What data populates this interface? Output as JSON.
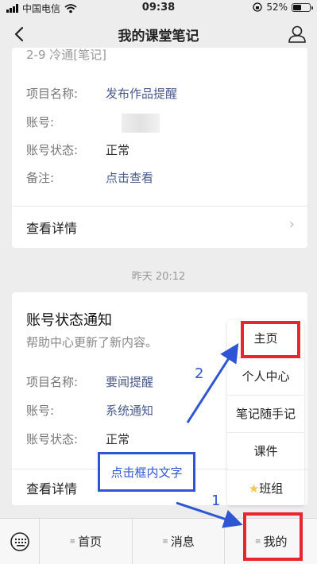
{
  "status_bar": {
    "carrier": "中国电信",
    "time": "09:38",
    "battery": "52%",
    "battery_level": 0.52
  },
  "nav": {
    "title": "我的课堂笔记",
    "back_icon": "chevron-left-icon",
    "profile_icon": "user-icon"
  },
  "card1": {
    "partial_header": "2-9 冷通[笔记]",
    "rows": [
      {
        "key": "项目名称:",
        "value": "发布作品提醒"
      },
      {
        "key": "账号:",
        "value": ""
      },
      {
        "key": "账号状态:",
        "value": "正常"
      },
      {
        "key": "备注:",
        "value": "点击查看"
      }
    ],
    "detail": "查看详情"
  },
  "timestamp": "昨天 20:12",
  "card2": {
    "title": "账号状态通知",
    "subtitle": "帮助中心更新了新内容。",
    "rows": [
      {
        "key": "项目名称:",
        "value": "要闻提醒"
      },
      {
        "key": "账号:",
        "value": "系统通知"
      },
      {
        "key": "账号状态:",
        "value": "正常"
      }
    ],
    "detail": "查看详情"
  },
  "popup_menu": {
    "items": [
      "主页",
      "个人中心",
      "笔记随手记",
      "课件",
      "班组"
    ]
  },
  "tabbar": {
    "keyboard_icon": "keyboard-icon",
    "tabs": [
      "首页",
      "消息",
      "我的"
    ]
  },
  "annotations": {
    "box_text": "点击框内文字",
    "step1": "1",
    "step2": "2"
  },
  "colors": {
    "highlight_red": "#e8262e",
    "annotation_blue": "#2e55d4",
    "link_blue": "#4a5a8c"
  }
}
